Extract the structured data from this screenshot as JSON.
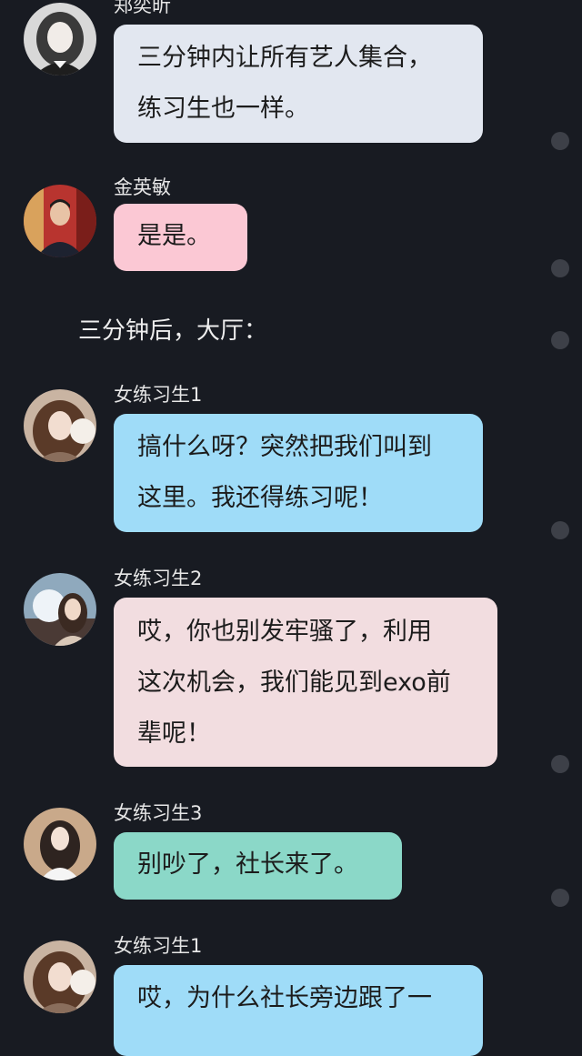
{
  "messages": [
    {
      "sender": "郑奕昕",
      "lines": [
        "三分钟内让所有艺人集合，",
        "练习生也一样。"
      ],
      "color": "#e2e7f0"
    },
    {
      "sender": "金英敏",
      "lines": [
        "是是。"
      ],
      "color": "#fbc8d4"
    },
    {
      "sender": "女练习生1",
      "lines": [
        "搞什么呀？突然把我们叫到",
        "这里。我还得练习呢！"
      ],
      "color": "#9fdcf8"
    },
    {
      "sender": "女练习生2",
      "lines": [
        "哎，你也别发牢骚了，利用",
        "这次机会，我们能见到exo前",
        "辈呢！"
      ],
      "color": "#f2dde0"
    },
    {
      "sender": "女练习生3",
      "lines": [
        "别吵了，社长来了。"
      ],
      "color": "#8bd8c8"
    },
    {
      "sender": "女练习生1",
      "lines": [
        "哎，为什么社长旁边跟了一"
      ],
      "color": "#9fdcf8"
    }
  ],
  "narration": "三分钟后，大厅："
}
